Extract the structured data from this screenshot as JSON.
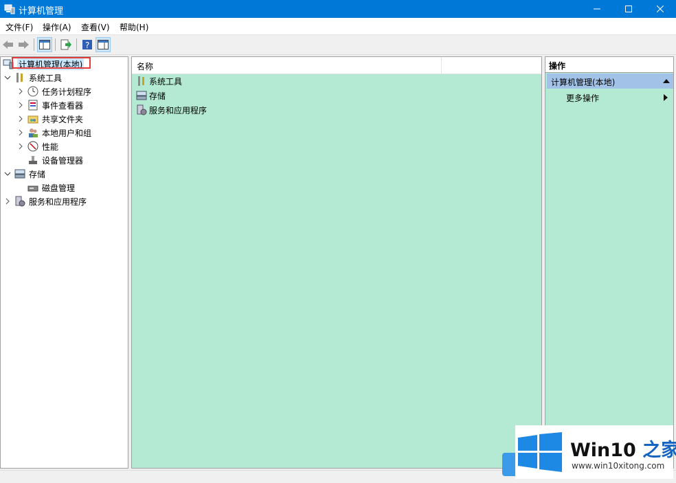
{
  "window": {
    "title": "计算机管理"
  },
  "menu": [
    "文件(F)",
    "操作(A)",
    "查看(V)",
    "帮助(H)"
  ],
  "tree": {
    "root": "计算机管理(本地)",
    "system_tools": "系统工具",
    "task_scheduler": "任务计划程序",
    "event_viewer": "事件查看器",
    "shared_folders": "共享文件夹",
    "local_users": "本地用户和组",
    "performance": "性能",
    "device_manager": "设备管理器",
    "storage": "存储",
    "disk_mgmt": "磁盘管理",
    "services_apps": "服务和应用程序"
  },
  "main": {
    "column_name": "名称",
    "rows": [
      "系统工具",
      "存储",
      "服务和应用程序"
    ]
  },
  "actions": {
    "header": "操作",
    "section": "计算机管理(本地)",
    "more": "更多操作"
  },
  "watermark": {
    "brand": "Win10",
    "brand_zh": "之家",
    "url": "www.win10xitong.com"
  },
  "colors": {
    "titlebar": "#0078d7",
    "pane_bg": "#b4e9d3",
    "highlight": "#e03c3c"
  }
}
